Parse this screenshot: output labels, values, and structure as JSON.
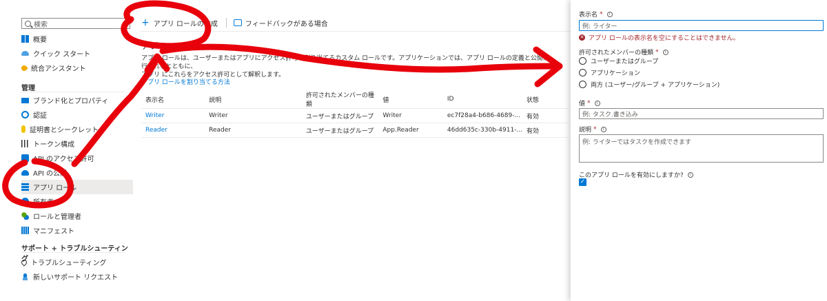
{
  "nav": {
    "search_placeholder": "検索",
    "items_top": [
      {
        "label": "概要",
        "icon": "grid-icon"
      },
      {
        "label": "クイック スタート",
        "icon": "cloud-icon"
      },
      {
        "label": "統合アシスタント",
        "icon": "rocket-icon"
      }
    ],
    "section_manage": "管理",
    "items_manage": [
      {
        "label": "ブランド化とプロパティ",
        "icon": "branding-icon"
      },
      {
        "label": "認証",
        "icon": "auth-icon"
      },
      {
        "label": "証明書とシークレット",
        "icon": "key-icon"
      },
      {
        "label": "トークン構成",
        "icon": "bars-icon"
      },
      {
        "label": "API のアクセス許可",
        "icon": "api-permission-icon"
      },
      {
        "label": "API の公開",
        "icon": "cloud-api-icon"
      },
      {
        "label": "アプリ ロール",
        "icon": "app-roles-icon"
      },
      {
        "label": "所有者",
        "icon": "owners-icon"
      },
      {
        "label": "ロールと管理者",
        "icon": "roles-admins-icon"
      },
      {
        "label": "マニフェスト",
        "icon": "manifest-icon"
      }
    ],
    "section_support": "サポート + トラブルシューティング",
    "items_support": [
      {
        "label": "トラブルシューティング",
        "icon": "wrench-icon"
      },
      {
        "label": "新しいサポート リクエスト",
        "icon": "support-icon"
      }
    ]
  },
  "main": {
    "create_label": "アプリ ロールの作成",
    "feedback_label": "フィードバックがある場合",
    "title": "アプリ ロール",
    "description_line1": "アプリ ロールは、ユーザーまたはアプリにアクセス許可を割り当てるカスタム ロールです。アプリケーションでは、アプリ ロールの定義と公開が行われるとともに、",
    "description_line2": "アプリ にこれらをアクセス許可として解釈します。",
    "howto_link": "アプリ ロールを割り当てる方法",
    "table": {
      "headers": [
        "表示名",
        "説明",
        "許可されたメンバーの種類",
        "値",
        "ID",
        "状態"
      ],
      "rows": [
        [
          "Writer",
          "Writer",
          "ユーザーまたはグループ",
          "Writer",
          "ec7f28a4-b686-4689-...",
          "有効"
        ],
        [
          "Reader",
          "Reader",
          "ユーザーまたはグループ",
          "App.Reader",
          "46dd635c-330b-4911-...",
          "有効"
        ]
      ]
    }
  },
  "panel": {
    "display_name_label": "表示名",
    "display_name_placeholder": "例: ライター",
    "display_name_error": "アプリ ロールの表示名を空にすることはできません。",
    "member_types_label": "許可されたメンバーの種類",
    "member_options": [
      "ユーザーまたはグループ",
      "アプリケーション",
      "両方 (ユーザー/グループ + アプリケーション)"
    ],
    "value_label": "値",
    "value_placeholder": "例: タスク.書き込み",
    "description_label": "説明",
    "description_placeholder": "例: ライターではタスクを作成できます",
    "enable_label": "このアプリ ロールを有効にしますか?",
    "enable_checked": true
  },
  "colors": {
    "accent": "#0078d4",
    "error": "#a4262c",
    "annotation": "#e8000b"
  }
}
